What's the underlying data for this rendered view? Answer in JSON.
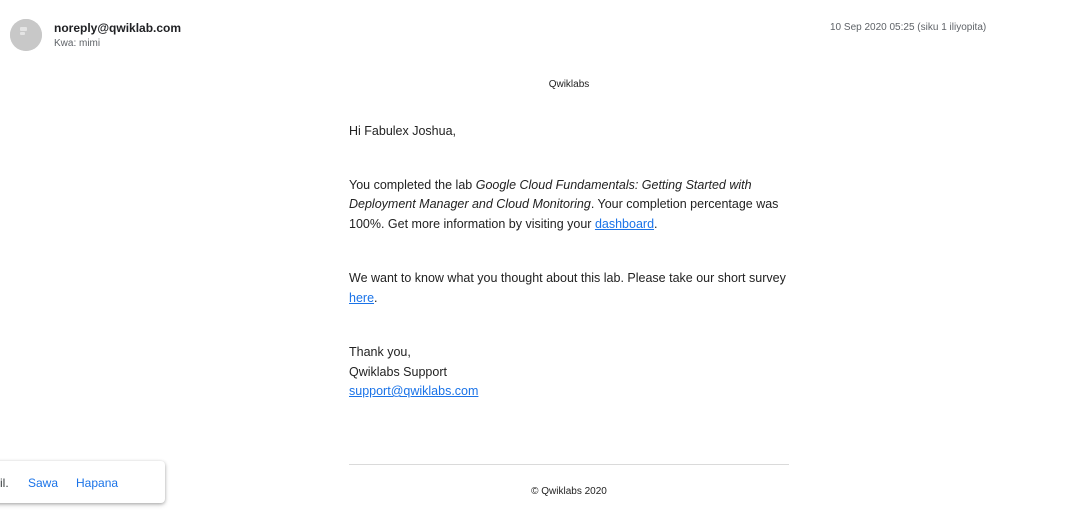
{
  "header": {
    "sender": "noreply@qwiklab.com",
    "recipient": "Kwa: mimi",
    "timestamp": "10 Sep 2020 05:25 (siku 1 iliyopita)"
  },
  "email": {
    "brand": "Qwiklabs",
    "greeting": "Hi Fabulex Joshua,",
    "para1_prefix": "You completed the lab ",
    "lab_name": "Google Cloud Fundamentals: Getting Started with Deployment Manager and Cloud Monitoring",
    "para1_middle": ". Your completion percentage was 100%. Get more information by visiting your ",
    "dashboard_link": "dashboard",
    "para1_suffix": ".",
    "para2_prefix": "We want to know what you thought about this lab. Please take our short survey ",
    "survey_link": "here",
    "para2_suffix": ".",
    "signoff": "Thank you,",
    "signature_name": "Qwiklabs Support",
    "signature_email": "support@qwiklabs.com",
    "footer": "© Qwiklabs 2020"
  },
  "toast": {
    "text": "il.",
    "accept_label": "Sawa",
    "decline_label": "Hapana"
  },
  "colors": {
    "link": "#1a73e8",
    "text": "#222222",
    "muted": "#5f6368",
    "avatar": "#c8c8c8"
  },
  "icons": {
    "avatar": "person-avatar-icon"
  }
}
